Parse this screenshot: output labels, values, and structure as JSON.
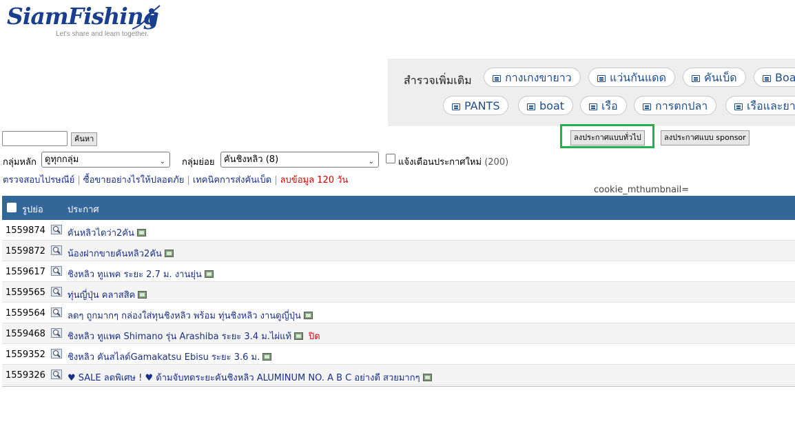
{
  "logo": {
    "name": "SiamFishing",
    "tagline": "Let's share and learn together."
  },
  "explore": {
    "label": "สำรวจเพิ่มเติม",
    "pills_row1": [
      "กางเกงขายาว",
      "แว่นกันแดด",
      "คันเบ็ด",
      "Boa"
    ],
    "pills_row2": [
      "PANTS",
      "boat",
      "เรือ",
      "การตกปลา",
      "เรือและยา"
    ]
  },
  "actions": {
    "post_general": "ลงประกาศแบบทั่วไป",
    "post_sponsor": "ลงประกาศแบบ sponsor"
  },
  "search": {
    "value": "",
    "button": "ค้นหา"
  },
  "filters": {
    "main_label": "กลุ่มหลัก",
    "main_value": "ดูทุกกลุ่ม",
    "sub_label": "กลุ่มย่อย",
    "sub_value": "คันชิงหลิว (8)",
    "notify_label": "แจ้งเตือนประกาศใหม่",
    "notify_count": "(200)"
  },
  "links": {
    "check_post": "ตรวจสอบไปรษณีย์",
    "safe_trade": "ซื้อขายอย่างไรให้ปลอดภัย",
    "ship_tech": "เทคนิคการส่งคันเบ็ด",
    "delete_data": "ลบข้อมูล 120 วัน"
  },
  "cookie_text": "cookie_mthumbnail=",
  "table": {
    "col_thumb": "รูปย่อ",
    "col_post": "ประกาศ",
    "rows": [
      {
        "id": "1559874",
        "title": "คันหลิวไดว่า2คัน",
        "status": ""
      },
      {
        "id": "1559872",
        "title": "น้องฝากขายคันหลิว2คัน",
        "status": ""
      },
      {
        "id": "1559617",
        "title": "ชิงหลิว ทูแพค ระยะ 2.7 ม. งานยุ่น",
        "status": ""
      },
      {
        "id": "1559565",
        "title": "ทุ่นญี่ปุ่น คลาสสิค",
        "status": ""
      },
      {
        "id": "1559564",
        "title": "ลดๆ ถูกมากๆ กล่องใส่ทุนชิงหลิว พร้อม ทุ่นชิงหลิว งานดูญี่ปุ่น",
        "status": ""
      },
      {
        "id": "1559468",
        "title": "ชิงหลิว ทูแพค Shimano รุ่น Arashiba ระยะ 3.4 ม.ไผ่แท้",
        "status": "ปิด"
      },
      {
        "id": "1559352",
        "title": "ชิงหลิว คันสไลด์Gamakatsu Ebisu ระยะ 3.6 ม.",
        "status": ""
      },
      {
        "id": "1559326",
        "title": "♥ SALE ลดพิเศษ ! ♥ ด้ามจับทดระยะคันชิงหลิว ALUMINUM NO. A B C อย่างดี สวยมากๆ",
        "status": ""
      }
    ]
  }
}
